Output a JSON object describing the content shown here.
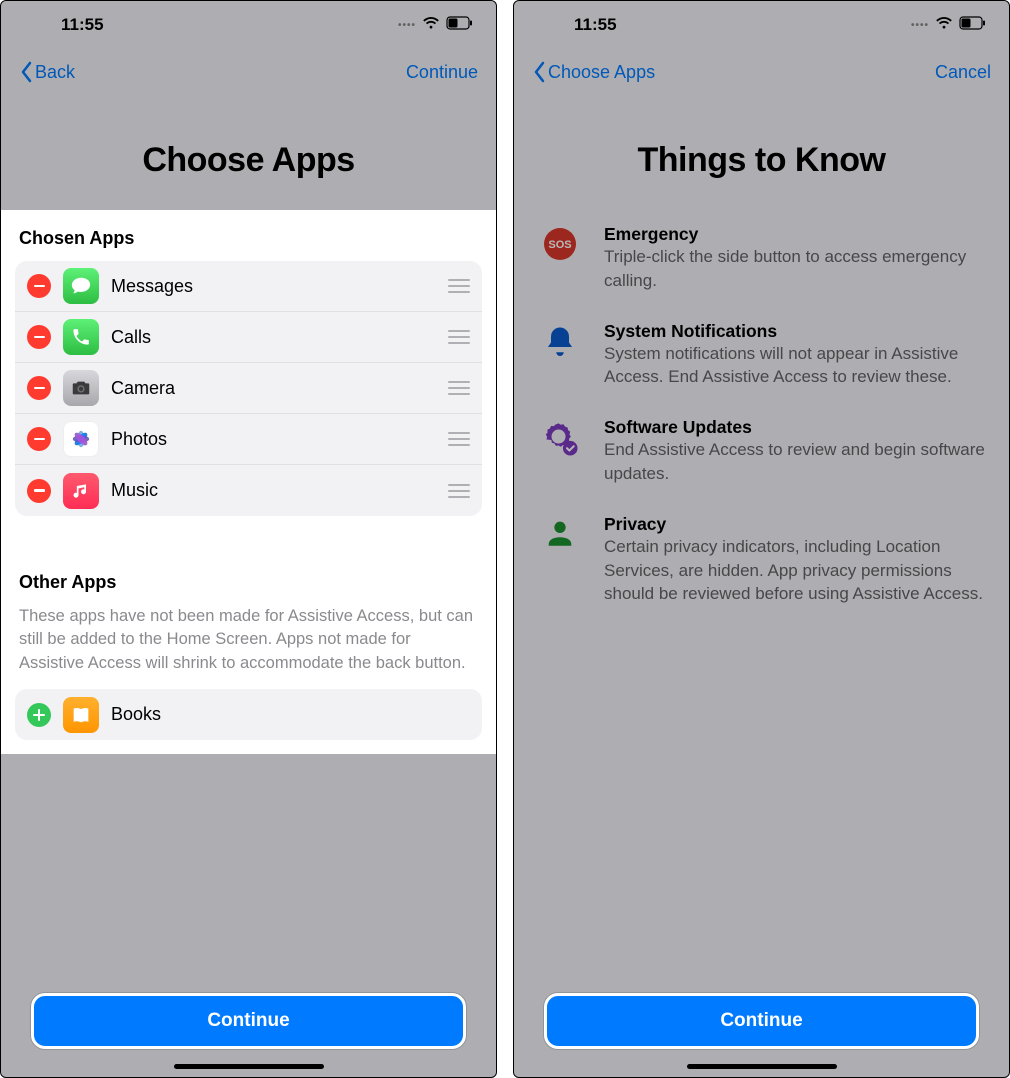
{
  "left": {
    "status_time": "11:55",
    "nav_back": "Back",
    "nav_action": "Continue",
    "title": "Choose Apps",
    "chosen_header": "Chosen Apps",
    "chosen": [
      {
        "name": "Messages",
        "icon": "messages"
      },
      {
        "name": "Calls",
        "icon": "calls"
      },
      {
        "name": "Camera",
        "icon": "camera"
      },
      {
        "name": "Photos",
        "icon": "photos"
      },
      {
        "name": "Music",
        "icon": "music"
      }
    ],
    "other_header": "Other Apps",
    "other_desc": "These apps have not been made for Assistive Access, but can still be added to the Home Screen. Apps not made for Assistive Access will shrink to accommodate the back button.",
    "other": [
      {
        "name": "Books",
        "icon": "books"
      }
    ],
    "continue": "Continue"
  },
  "right": {
    "status_time": "11:55",
    "nav_back": "Choose Apps",
    "nav_action": "Cancel",
    "title": "Things to Know",
    "items": [
      {
        "icon": "sos",
        "icon_color": "#d9372c",
        "title": "Emergency",
        "body": "Triple-click the side button to access emergency calling."
      },
      {
        "icon": "bell",
        "icon_color": "#0a5bcc",
        "title": "System Notifications",
        "body": "System notifications will not appear in Assistive Access. End Assistive Access to review these."
      },
      {
        "icon": "gear",
        "icon_color": "#7d3bbf",
        "title": "Software Updates",
        "body": "End Assistive Access to review and begin software updates."
      },
      {
        "icon": "person",
        "icon_color": "#1a8f2e",
        "title": "Privacy",
        "body": "Certain privacy indicators, including Location Services, are hidden. App privacy permissions should be reviewed before using Assistive Access."
      }
    ],
    "continue": "Continue"
  }
}
